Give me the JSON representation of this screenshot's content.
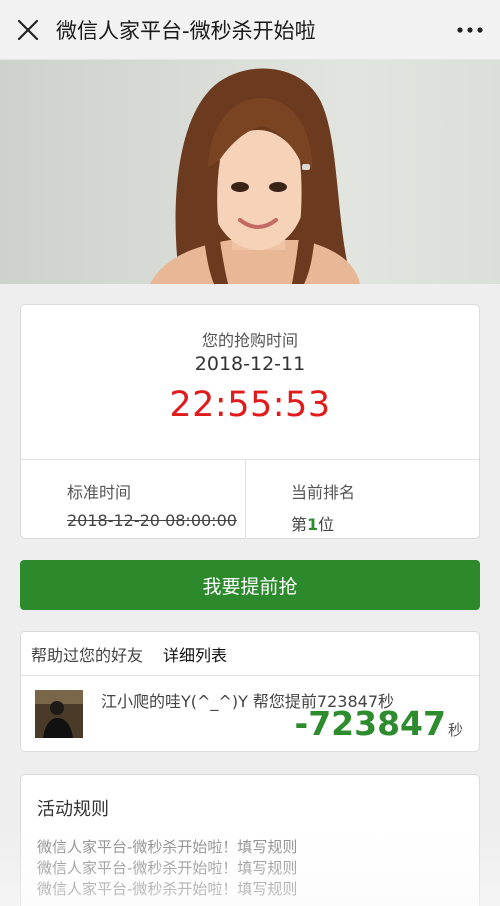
{
  "topbar": {
    "title": "微信人家平台-微秒杀开始啦",
    "close_icon": "close-icon",
    "more_icon": "more-icon"
  },
  "hero": {
    "image": "portrait-photo"
  },
  "time_card": {
    "label": "您的抢购时间",
    "date": "2018-12-11",
    "countdown": "22:55:53",
    "standard_time_label": "标准时间",
    "standard_time_value": "2018-12-20 08:00:00",
    "rank_label": "当前排名",
    "rank_prefix": "第",
    "rank_number": "1",
    "rank_suffix": "位",
    "countdown_color": "#e01b1b"
  },
  "grab_button": {
    "label": "我要提前抢",
    "color": "#2c8a2c"
  },
  "friends": {
    "header_label": "帮助过您的好友",
    "detail_link": "详细列表",
    "items": [
      {
        "text": "江小爬的哇Y(^_^)Y 帮您提前723847秒",
        "amount": "-723847",
        "unit": "秒"
      }
    ]
  },
  "rules": {
    "title": "活动规则",
    "lines": [
      "微信人家平台-微秒杀开始啦！填写规则",
      "微信人家平台-微秒杀开始啦！填写规则",
      "微信人家平台-微秒杀开始啦！填写规则"
    ]
  }
}
